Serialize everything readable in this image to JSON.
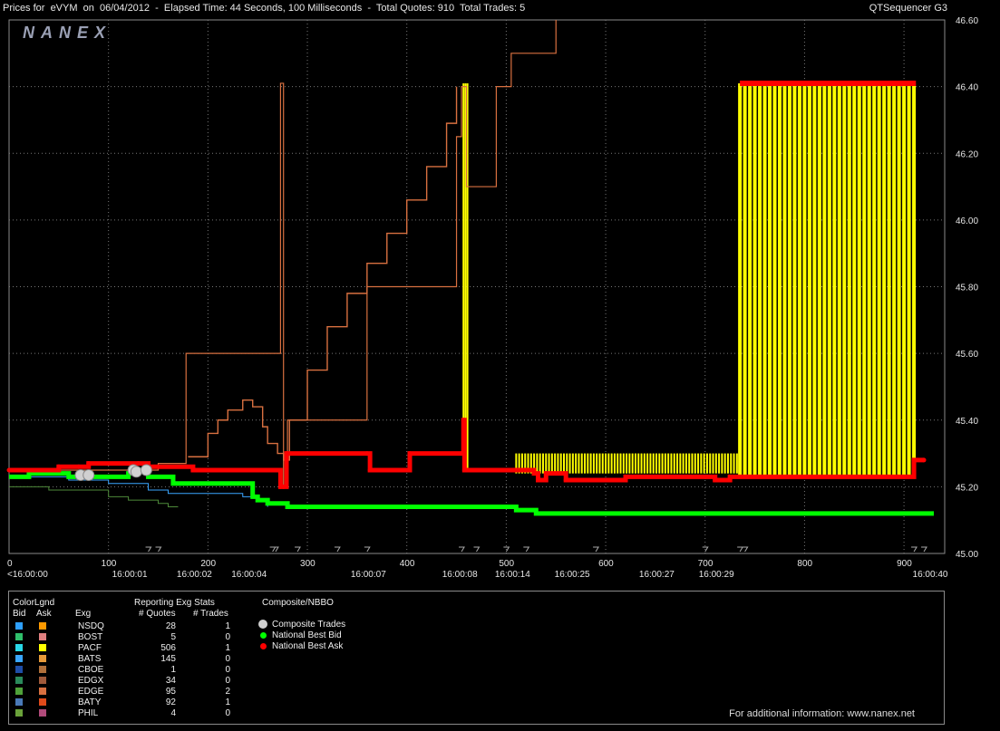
{
  "header": {
    "title": "Prices for  eVYM  on  06/04/2012  -  Elapsed Time: 44 Seconds, 100 Milliseconds  -  Total Quotes: 910  Total Trades: 5",
    "app_name": "QTSequencer G3"
  },
  "logo": {
    "text": "NANEX"
  },
  "chart_data": {
    "type": "line",
    "ylim": [
      45.0,
      46.6
    ],
    "y_ticks": [
      "45.00",
      "45.20",
      "45.40",
      "45.60",
      "45.80",
      "46.00",
      "46.20",
      "46.40",
      "46.60"
    ],
    "xlim": [
      0,
      930
    ],
    "x_ticks": [
      "0",
      "100",
      "200",
      "300",
      "400",
      "500",
      "600",
      "700",
      "800",
      "900"
    ],
    "time_ticks": [
      {
        "x": 0,
        "label": "<16:00:00"
      },
      {
        "x": 120,
        "label": "16:00:01"
      },
      {
        "x": 185,
        "label": "16:00:02"
      },
      {
        "x": 240,
        "label": "16:00:04"
      },
      {
        "x": 360,
        "label": "16:00:07"
      },
      {
        "x": 452,
        "label": "16:00:08"
      },
      {
        "x": 505,
        "label": "16:00:14"
      },
      {
        "x": 565,
        "label": "16:00:25"
      },
      {
        "x": 650,
        "label": "16:00:27"
      },
      {
        "x": 710,
        "label": "16:00:29"
      },
      {
        "x": 925,
        "label": "16:00:40"
      }
    ],
    "nbbo_ask": {
      "color": "#ff0000",
      "x": [
        0,
        10,
        50,
        70,
        80,
        130,
        140,
        185,
        270,
        273,
        276,
        279,
        280,
        360,
        363,
        400,
        403,
        455,
        457,
        458,
        510,
        528,
        532,
        540,
        560,
        620,
        700,
        710,
        725,
        900,
        910,
        920
      ],
      "y": [
        45.25,
        45.25,
        45.26,
        45.26,
        45.27,
        45.27,
        45.26,
        45.25,
        45.25,
        45.2,
        45.2,
        45.3,
        45.3,
        45.3,
        45.25,
        45.25,
        45.3,
        45.3,
        45.4,
        45.25,
        45.25,
        45.24,
        45.22,
        45.24,
        45.22,
        45.23,
        45.23,
        45.22,
        45.23,
        45.23,
        45.28,
        45.28
      ]
    },
    "nbbo_bid": {
      "color": "#00ff00",
      "x": [
        0,
        20,
        60,
        100,
        120,
        130,
        140,
        165,
        190,
        200,
        210,
        220,
        245,
        250,
        260,
        280,
        500,
        510,
        530,
        930
      ],
      "y": [
        45.23,
        45.24,
        45.23,
        45.23,
        45.24,
        45.25,
        45.23,
        45.21,
        45.21,
        45.21,
        45.21,
        45.21,
        45.17,
        45.16,
        45.15,
        45.14,
        45.14,
        45.13,
        45.12,
        45.12
      ]
    },
    "composite_trades": {
      "color": "#d0d0d0",
      "x": [
        72,
        80,
        125,
        128,
        138
      ],
      "y": [
        45.235,
        45.235,
        45.25,
        45.245,
        45.25
      ]
    },
    "pacf_quotes": {
      "color": "#ffff00",
      "bid_x": [
        455,
        460,
        730
      ],
      "ask_y": 46.41,
      "band_start_x": 735,
      "band_end_x": 912,
      "band_low": 45.23,
      "band_high": 46.41
    },
    "edge_ask_path": {
      "color": "#d87040",
      "x": [
        0,
        150,
        175,
        178,
        178,
        270,
        273,
        276,
        276,
        279,
        280,
        360,
        450,
        455,
        460,
        460,
        485,
        490,
        500,
        505,
        507,
        515,
        540,
        550
      ],
      "y": [
        45.25,
        45.27,
        45.27,
        45.3,
        45.6,
        45.6,
        46.41,
        46.41,
        45.2,
        45.25,
        45.4,
        45.8,
        46.25,
        46.4,
        46.4,
        46.1,
        46.1,
        46.4,
        46.4,
        46.5,
        46.5,
        46.5,
        46.5,
        46.6
      ]
    },
    "edge_bid_path": {
      "color": "#d87040",
      "x": [
        180,
        200,
        210,
        220,
        235,
        245,
        255,
        260,
        270,
        276,
        282,
        300,
        320,
        340,
        360,
        380,
        400,
        420,
        440,
        450
      ],
      "y": [
        45.29,
        45.36,
        45.4,
        45.43,
        45.46,
        45.44,
        45.38,
        45.33,
        45.3,
        45.28,
        45.4,
        45.55,
        45.68,
        45.78,
        45.87,
        45.96,
        46.06,
        46.16,
        46.29,
        46.4
      ]
    },
    "bats_bid": {
      "color": "#3aa6ff",
      "x": [
        0,
        60,
        100,
        130,
        140,
        160,
        220,
        235,
        245,
        250,
        260
      ],
      "y": [
        45.23,
        45.22,
        45.21,
        45.21,
        45.19,
        45.18,
        45.18,
        45.17,
        45.17,
        45.16,
        45.14
      ]
    },
    "green_tail": {
      "color": "#4e8a3a",
      "x": [
        0,
        40,
        80,
        100,
        120,
        150,
        160,
        170
      ],
      "y": [
        45.2,
        45.19,
        45.19,
        45.17,
        45.16,
        45.15,
        45.14,
        45.14
      ]
    }
  },
  "legend": {
    "header_colorlgnd": "ColorLgnd",
    "header_bid": "Bid",
    "header_ask": "Ask",
    "header_exg": "Exg",
    "header_stats": "Reporting Exg Stats",
    "header_quotes": "# Quotes",
    "header_trades": "# Trades",
    "header_cnbbo": "Composite/NBBO",
    "rows": [
      {
        "exg": "NSDQ",
        "quotes": "28",
        "trades": "1",
        "bid_color": "#2ea0ff",
        "ask_color": "#ff9a00"
      },
      {
        "exg": "BOST",
        "quotes": "5",
        "trades": "0",
        "bid_color": "#2fbf6a",
        "ask_color": "#e08080"
      },
      {
        "exg": "PACF",
        "quotes": "506",
        "trades": "1",
        "bid_color": "#29d8e8",
        "ask_color": "#ffff00"
      },
      {
        "exg": "BATS",
        "quotes": "145",
        "trades": "0",
        "bid_color": "#39a6ff",
        "ask_color": "#e69a3a"
      },
      {
        "exg": "CBOE",
        "quotes": "1",
        "trades": "0",
        "bid_color": "#1e4ea8",
        "ask_color": "#b0703a"
      },
      {
        "exg": "EDGX",
        "quotes": "34",
        "trades": "0",
        "bid_color": "#2a8a5a",
        "ask_color": "#a05a3a"
      },
      {
        "exg": "EDGE",
        "quotes": "95",
        "trades": "2",
        "bid_color": "#4fa23a",
        "ask_color": "#d87040"
      },
      {
        "exg": "BATY",
        "quotes": "92",
        "trades": "1",
        "bid_color": "#4a7ab8",
        "ask_color": "#e04a1a"
      },
      {
        "exg": "PHIL",
        "quotes": "4",
        "trades": "0",
        "bid_color": "#6aa23a",
        "ask_color": "#b04a7a"
      }
    ],
    "composite": [
      {
        "label": "Composite Trades",
        "color": "#d0d0d0"
      },
      {
        "label": "National Best Bid",
        "color": "#00ff00"
      },
      {
        "label": "National Best Ask",
        "color": "#ff0000"
      }
    ],
    "footer": "For additional information: www.nanex.net"
  }
}
